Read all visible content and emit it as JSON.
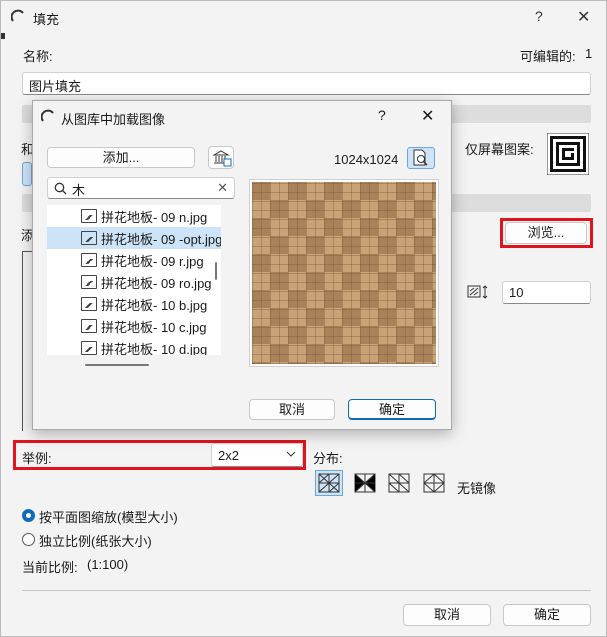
{
  "window": {
    "title": "填充",
    "help": "?",
    "close": "✕"
  },
  "name_label": "名称:",
  "editable_label": "可编辑的:",
  "editable_value": "1",
  "name_value": "图片填充",
  "side_label_1": "和",
  "side_label_2": "添",
  "screen_only_label": "仅屏幕图案:",
  "browse_button": "浏览...",
  "stretch_value": "10",
  "example_label": "举例:",
  "example_select": "2x2",
  "distribution_label": "分布:",
  "no_mirror_label": "无镜像",
  "radio_scale_plan": "按平面图缩放(模型大小)",
  "radio_independent": "独立比例(纸张大小)",
  "current_scale_label": "当前比例:",
  "current_scale_value": "(1:100)",
  "outer_cancel": "取消",
  "outer_ok": "确定",
  "inner": {
    "title": "从图库中加载图像",
    "help": "?",
    "close": "✕",
    "add_button": "添加...",
    "resolution": "1024x1024",
    "search_value": "木",
    "clear": "✕",
    "files": [
      "拼花地板- 09 n.jpg",
      "拼花地板- 09 -opt.jpg",
      "拼花地板- 09 r.jpg",
      "拼花地板- 09 ro.jpg",
      "拼花地板- 10 b.jpg",
      "拼花地板- 10 c.jpg",
      "拼花地板- 10 d.jpg"
    ],
    "selected_index": 1,
    "cancel": "取消",
    "ok": "确定"
  },
  "colors": {
    "accent": "#0f6cbd",
    "highlight_red": "#e0141e",
    "selection": "#cde3f7"
  }
}
